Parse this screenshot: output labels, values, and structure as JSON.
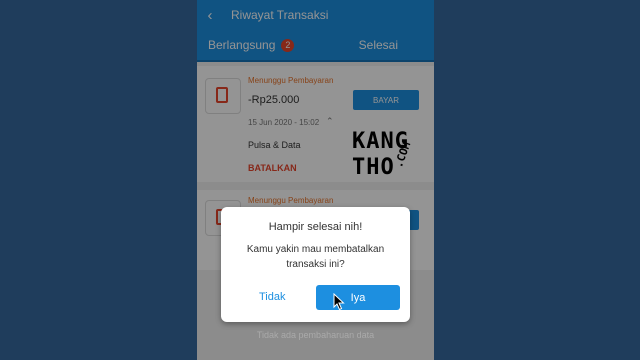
{
  "appbar": {
    "title": "Riwayat Transaksi",
    "back_icon": "arrow-left-icon"
  },
  "tabs": {
    "active_label": "Berlangsung",
    "active_badge": "2",
    "inactive_label": "Selesai"
  },
  "transactions": [
    {
      "status": "Menunggu Pembayaran",
      "amount": "-Rp25.000",
      "pay_label": "BAYAR",
      "date": "15 Jun 2020 - 15:02",
      "category": "Pulsa & Data",
      "cancel_label": "BATALKAN"
    },
    {
      "status": "Menunggu Pembayaran"
    }
  ],
  "footer_note": "Tidak ada pembaharuan data",
  "dialog": {
    "title": "Hampir selesai nih!",
    "message": "Kamu yakin mau membatalkan transaksi ini?",
    "cancel_label": "Tidak",
    "confirm_label": "Iya"
  },
  "watermark": {
    "line1": "KANG",
    "line2": "THO",
    "suffix": ".COM"
  },
  "colors": {
    "primary": "#1d8fe0",
    "danger": "#e8452c",
    "warning": "#e8742c",
    "background": "#1f3d5c"
  }
}
